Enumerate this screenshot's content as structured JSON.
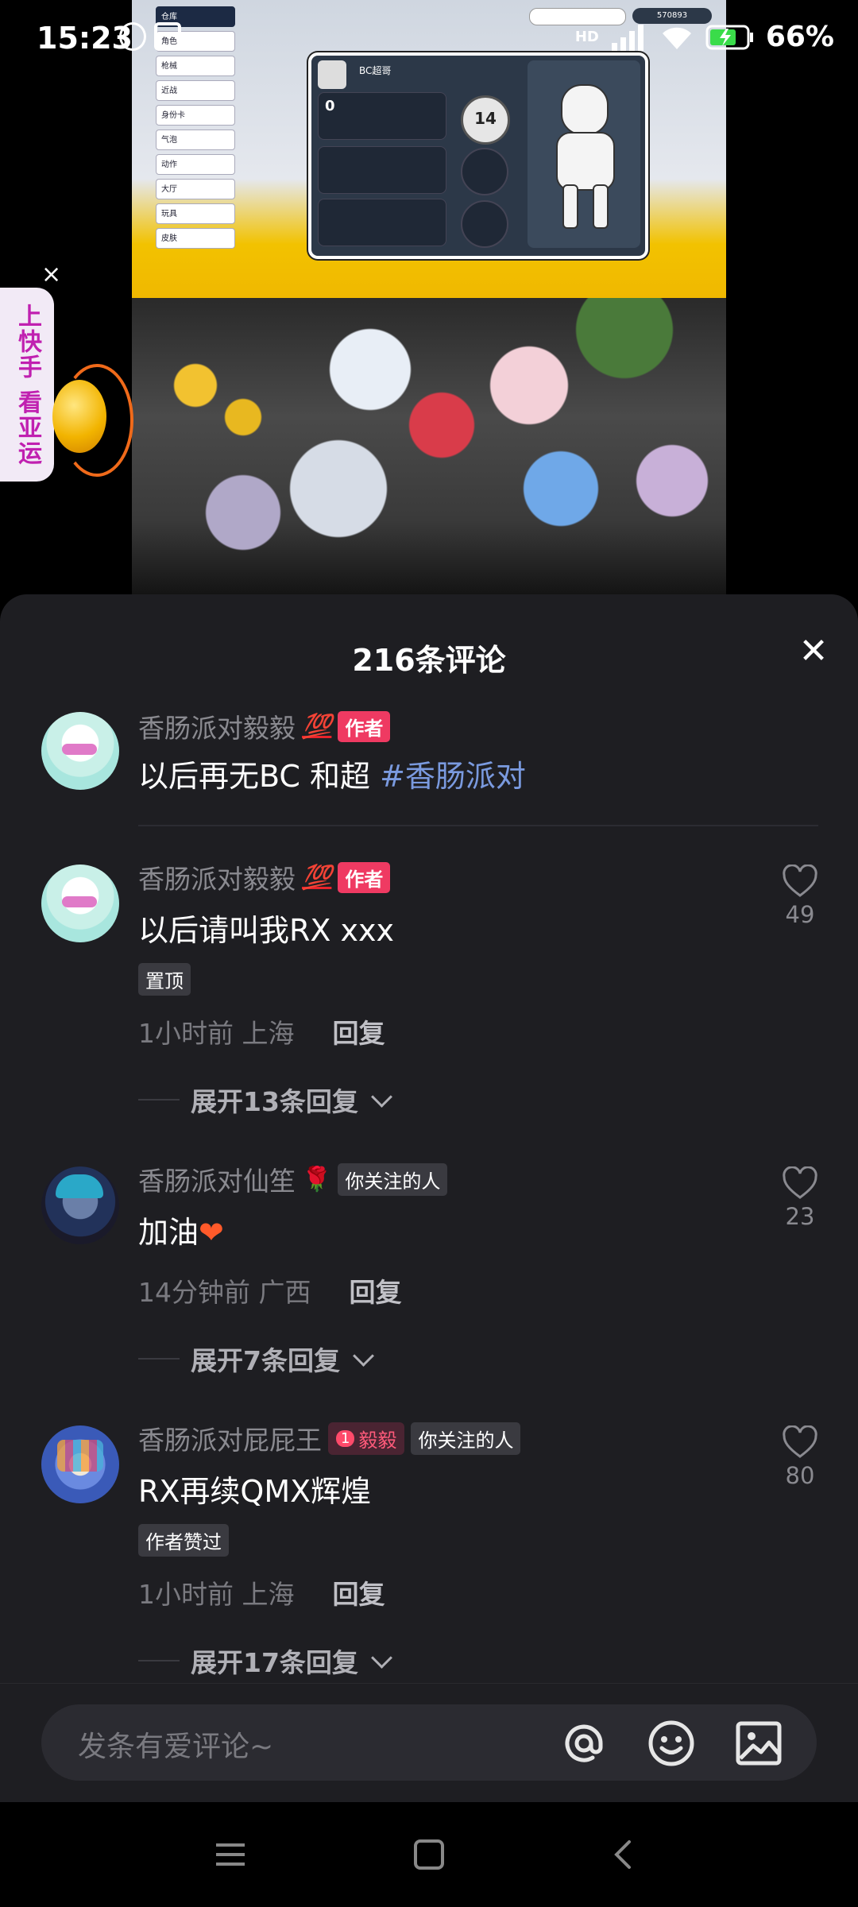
{
  "status_bar": {
    "time": "15:23",
    "network": "HD",
    "battery": "66%"
  },
  "video": {
    "game_menu": [
      "仓库",
      "角色",
      "枪械",
      "近战",
      "身份卡",
      "气泡",
      "动作",
      "大厅",
      "玩具",
      "皮肤"
    ],
    "game_player_name": "BC超哥",
    "game_stat_value": "0",
    "game_level": "14",
    "game_coins": "570893"
  },
  "ad": {
    "text": "上快手 看亚运",
    "close_label": "×"
  },
  "comments_header": {
    "title": "216条评论",
    "close_label": "✕"
  },
  "comments": [
    {
      "username": "香肠派对毅毅",
      "emoji": "💯",
      "tag": "作者",
      "text": "以后再无BC 和超 ",
      "hashtag": "#香肠派对"
    },
    {
      "username": "香肠派对毅毅",
      "emoji": "💯",
      "tag": "作者",
      "text": "以后请叫我RX xxx",
      "pin_label": "置顶",
      "time": "1小时前",
      "location": "上海",
      "reply_label": "回复",
      "expand_label": "展开13条回复",
      "likes": "49"
    },
    {
      "username": "香肠派对仙笙",
      "emoji": "🌹",
      "tag": "你关注的人",
      "text": "加油",
      "text_emoji": "❤",
      "time": "14分钟前",
      "location": "广西",
      "reply_label": "回复",
      "expand_label": "展开7条回复",
      "likes": "23"
    },
    {
      "username": "香肠派对屁屁王",
      "fan_level": "1",
      "fan_badge": "毅毅",
      "tag": "你关注的人",
      "text": "RX再续QMX辉煌",
      "pin_label": "作者赞过",
      "time": "1小时前",
      "location": "上海",
      "reply_label": "回复",
      "expand_label": "展开17条回复",
      "likes": "80"
    }
  ],
  "input_bar": {
    "placeholder": "发条有爱评论~",
    "icons": [
      "at-icon",
      "emoji-icon",
      "image-icon"
    ]
  },
  "colors": {
    "sheet_bg": "#1e1e22",
    "author_tag": "#ef3a62",
    "hashtag": "#7a9adf"
  }
}
